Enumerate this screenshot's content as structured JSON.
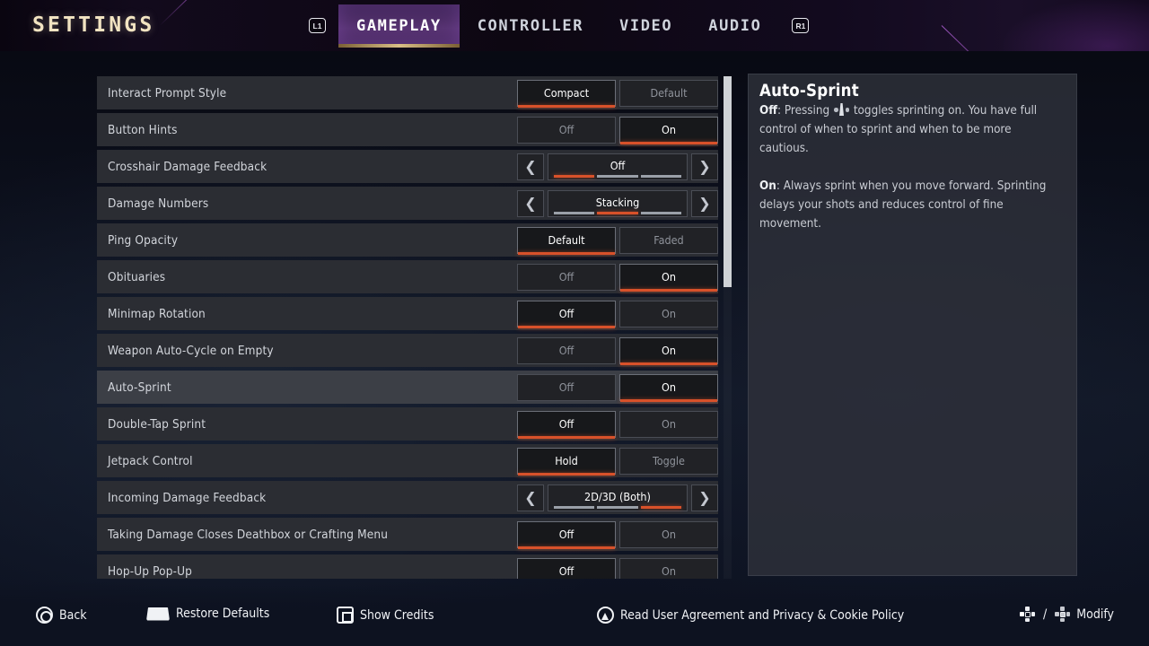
{
  "header": {
    "title": "SETTINGS",
    "bumper_left": "L1",
    "bumper_right": "R1",
    "tabs": [
      {
        "label": "GAMEPLAY",
        "active": true
      },
      {
        "label": "CONTROLLER",
        "active": false
      },
      {
        "label": "VIDEO",
        "active": false
      },
      {
        "label": "AUDIO",
        "active": false
      }
    ],
    "accent_purple": "#573372",
    "accent_gold": "#d9bf86"
  },
  "colors": {
    "selected_underline": "#d8512a",
    "row_bg": "#2b2d33",
    "row_highlight_bg": "#3c3f46",
    "scrollbar_thumb": "#cfd2d6"
  },
  "settings_rows": [
    {
      "label": "Interact Prompt Style",
      "type": "toggle",
      "options": [
        "Compact",
        "Default"
      ],
      "selected_index": 0,
      "highlighted": false
    },
    {
      "label": "Button Hints",
      "type": "toggle",
      "options": [
        "Off",
        "On"
      ],
      "selected_index": 1,
      "highlighted": false
    },
    {
      "label": "Crosshair Damage Feedback",
      "type": "slider",
      "value": "Off",
      "segments": 3,
      "active_segment": 0,
      "highlighted": false
    },
    {
      "label": "Damage Numbers",
      "type": "slider",
      "value": "Stacking",
      "segments": 3,
      "active_segment": 1,
      "highlighted": false
    },
    {
      "label": "Ping Opacity",
      "type": "toggle",
      "options": [
        "Default",
        "Faded"
      ],
      "selected_index": 0,
      "highlighted": false
    },
    {
      "label": "Obituaries",
      "type": "toggle",
      "options": [
        "Off",
        "On"
      ],
      "selected_index": 1,
      "highlighted": false
    },
    {
      "label": "Minimap Rotation",
      "type": "toggle",
      "options": [
        "Off",
        "On"
      ],
      "selected_index": 0,
      "highlighted": false
    },
    {
      "label": "Weapon Auto-Cycle on Empty",
      "type": "toggle",
      "options": [
        "Off",
        "On"
      ],
      "selected_index": 1,
      "highlighted": false
    },
    {
      "label": "Auto-Sprint",
      "type": "toggle",
      "options": [
        "Off",
        "On"
      ],
      "selected_index": 1,
      "highlighted": true
    },
    {
      "label": "Double-Tap Sprint",
      "type": "toggle",
      "options": [
        "Off",
        "On"
      ],
      "selected_index": 0,
      "highlighted": false
    },
    {
      "label": "Jetpack Control",
      "type": "toggle",
      "options": [
        "Hold",
        "Toggle"
      ],
      "selected_index": 0,
      "highlighted": false
    },
    {
      "label": "Incoming Damage Feedback",
      "type": "slider",
      "value": "2D/3D (Both)",
      "segments": 3,
      "active_segment": 2,
      "highlighted": false
    },
    {
      "label": "Taking Damage Closes Deathbox or Crafting Menu",
      "type": "toggle",
      "options": [
        "Off",
        "On"
      ],
      "selected_index": 0,
      "highlighted": false
    },
    {
      "label": "Hop-Up Pop-Up",
      "type": "toggle",
      "options": [
        "Off",
        "On"
      ],
      "selected_index": 0,
      "highlighted": false
    }
  ],
  "info_panel": {
    "title": "Auto-Sprint",
    "off_label": "Off",
    "off_text_before": ": Pressing ",
    "off_text_after": " toggles sprinting on.  You have full control of when to sprint and when to be more cautious.",
    "on_label": "On",
    "on_text": ": Always sprint when you move forward. Sprinting delays your shots and reduces control of fine movement."
  },
  "footer": {
    "items": [
      {
        "icon": "circle-button-icon",
        "label": "Back"
      },
      {
        "icon": "touchpad-button-icon",
        "label": "Restore Defaults"
      },
      {
        "icon": "square-button-icon",
        "label": "Show Credits"
      },
      {
        "icon": "triangle-button-icon",
        "label": "Read User Agreement and Privacy & Cookie Policy"
      },
      {
        "icon": "dpad-left-right-icon",
        "label": "Modify"
      }
    ]
  },
  "scrollbar": {
    "thumb_top_pct": 0,
    "thumb_height_pct": 42
  }
}
